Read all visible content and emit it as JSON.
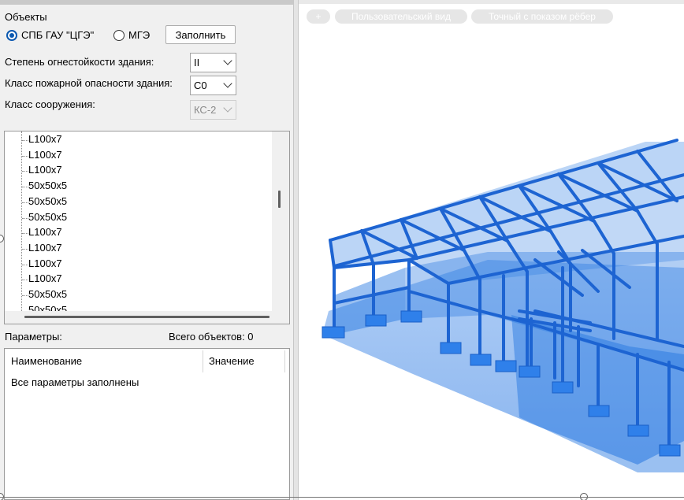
{
  "objects": {
    "title": "Объекты",
    "radios": [
      {
        "label": "СПБ ГАУ \"ЦГЭ\"",
        "checked": true
      },
      {
        "label": "МГЭ",
        "checked": false
      }
    ],
    "fill_button": "Заполнить"
  },
  "fields": {
    "fire_resistance": {
      "label": "Степень огнестойкости здания:",
      "value": "II"
    },
    "fire_hazard": {
      "label": "Класс пожарной опасности здания:",
      "value": "С0"
    },
    "structure_class": {
      "label": "Класс сооружения:",
      "value": "КС-2",
      "disabled": true
    }
  },
  "tree": {
    "items": [
      "L100x7",
      "L100x7",
      "L100x7",
      "50x50x5",
      "50x50x5",
      "50x50x5",
      "L100x7",
      "L100x7",
      "L100x7",
      "L100x7",
      "50x50x5",
      "50x50x5"
    ]
  },
  "params": {
    "title": "Параметры:",
    "count_label": "Всего объектов: 0",
    "col_name": "Наименование",
    "col_value": "Значение",
    "rows": [
      "Все параметры заполнены"
    ]
  },
  "viewport": {
    "chips": [
      "+",
      "Пользовательский вид",
      "Точный с показом рёбер"
    ],
    "structure_color": "#1f73e0"
  },
  "icons": [
    "radio-checked-icon",
    "radio-unchecked-icon",
    "chevron-down-icon"
  ]
}
